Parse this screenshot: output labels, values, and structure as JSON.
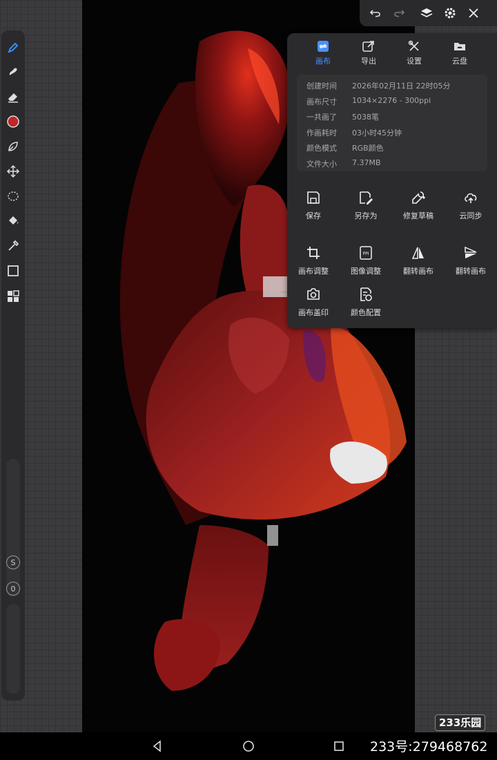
{
  "top_bar": {
    "buttons": [
      "undo-icon",
      "redo-icon",
      "layers-icon",
      "gear-icon",
      "close-icon"
    ]
  },
  "left_toolbar": {
    "tools": [
      "brush-icon",
      "smudge-icon",
      "eraser-icon",
      "color-swatch",
      "lasso-leaf-icon",
      "move-icon",
      "selection-icon",
      "fill-bucket-icon",
      "eyedropper-icon",
      "shape-icon",
      "grid-icon"
    ],
    "active_color": "#c0262a",
    "badge_s": "S",
    "badge_o": "0"
  },
  "panel": {
    "tabs": [
      {
        "label": "画布",
        "icon": "canvas-icon",
        "active": true
      },
      {
        "label": "导出",
        "icon": "export-icon",
        "active": false
      },
      {
        "label": "设置",
        "icon": "tools-icon",
        "active": false
      },
      {
        "label": "云盘",
        "icon": "cloud-folder-icon",
        "active": false
      }
    ],
    "info": [
      {
        "key": "创建时间",
        "value": "2026年02月11日 22时05分"
      },
      {
        "key": "画布尺寸",
        "value": "1034×2276 - 300ppi"
      },
      {
        "key": "一共画了",
        "value": "5038笔"
      },
      {
        "key": "作画耗时",
        "value": "03小时45分钟"
      },
      {
        "key": "颜色模式",
        "value": "RGB颜色"
      },
      {
        "key": "文件大小",
        "value": "7.37MB"
      }
    ],
    "actions": [
      {
        "label": "保存",
        "icon": "save-icon"
      },
      {
        "label": "另存为",
        "icon": "save-as-icon"
      },
      {
        "label": "修复草稿",
        "icon": "wrench-icon"
      },
      {
        "label": "云同步",
        "icon": "cloud-sync-icon"
      },
      {
        "label": "画布调整",
        "icon": "crop-icon"
      },
      {
        "label": "图像调整",
        "icon": "ppi-icon"
      },
      {
        "label": "翻转画布",
        "icon": "flip-horizontal-icon"
      },
      {
        "label": "翻转画布",
        "icon": "flip-vertical-icon"
      },
      {
        "label": "画布盖印",
        "icon": "camera-icon"
      },
      {
        "label": "颜色配置",
        "icon": "color-config-icon"
      }
    ],
    "accent": "#4a90ff"
  },
  "nav": {
    "watermark": "233乐园",
    "id_text": "233号:279468762"
  }
}
